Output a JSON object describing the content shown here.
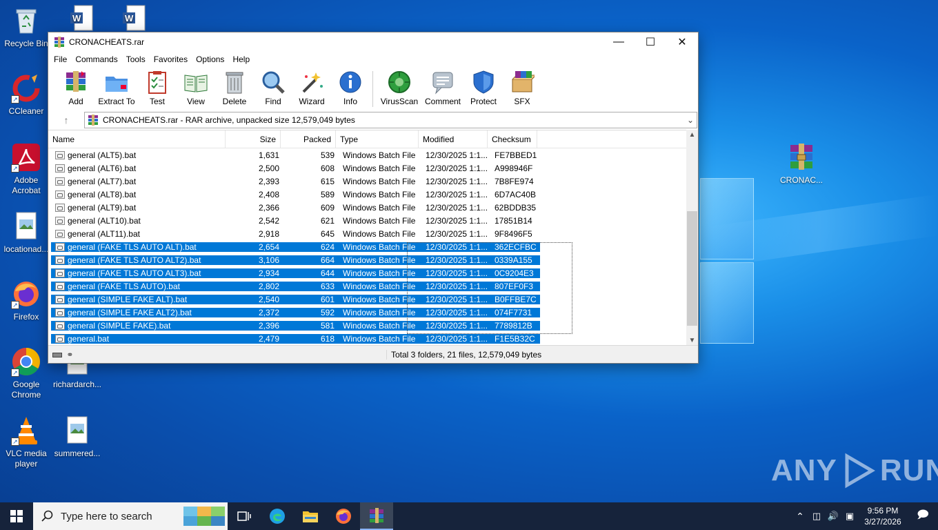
{
  "desktop": {
    "icons": [
      {
        "label": "Recycle Bin",
        "icon": "recycle-bin-icon"
      },
      {
        "label": "CCleaner",
        "icon": "ccleaner-icon"
      },
      {
        "label": "Adobe Acrobat",
        "icon": "acrobat-icon"
      },
      {
        "label": "locationad...",
        "icon": "image-file-icon"
      },
      {
        "label": "Firefox",
        "icon": "firefox-icon"
      },
      {
        "label": "Google Chrome",
        "icon": "chrome-icon"
      },
      {
        "label": "richardarch...",
        "icon": "image-file-icon"
      },
      {
        "label": "VLC media player",
        "icon": "vlc-icon"
      },
      {
        "label": "summered...",
        "icon": "image-file-icon"
      },
      {
        "label": "CRONAC...",
        "icon": "winrar-archive-icon"
      }
    ],
    "watermark": "ANY RUN"
  },
  "window": {
    "title": "CRONACHEATS.rar",
    "menu": [
      "File",
      "Commands",
      "Tools",
      "Favorites",
      "Options",
      "Help"
    ],
    "toolbar": [
      "Add",
      "Extract To",
      "Test",
      "View",
      "Delete",
      "Find",
      "Wizard",
      "Info",
      "VirusScan",
      "Comment",
      "Protect",
      "SFX"
    ],
    "address": "CRONACHEATS.rar - RAR archive, unpacked size 12,579,049 bytes",
    "columns": [
      "Name",
      "Size",
      "Packed",
      "Type",
      "Modified",
      "Checksum"
    ],
    "rows": [
      {
        "name": "general (ALT5).bat",
        "size": "1,631",
        "packed": "539",
        "type": "Windows Batch File",
        "modified": "12/30/2025 1:1...",
        "checksum": "FE7BBED1",
        "selected": false
      },
      {
        "name": "general (ALT6).bat",
        "size": "2,500",
        "packed": "608",
        "type": "Windows Batch File",
        "modified": "12/30/2025 1:1...",
        "checksum": "A998946F",
        "selected": false
      },
      {
        "name": "general (ALT7).bat",
        "size": "2,393",
        "packed": "615",
        "type": "Windows Batch File",
        "modified": "12/30/2025 1:1...",
        "checksum": "7B8FE974",
        "selected": false
      },
      {
        "name": "general (ALT8).bat",
        "size": "2,408",
        "packed": "589",
        "type": "Windows Batch File",
        "modified": "12/30/2025 1:1...",
        "checksum": "6D7AC40B",
        "selected": false
      },
      {
        "name": "general (ALT9).bat",
        "size": "2,366",
        "packed": "609",
        "type": "Windows Batch File",
        "modified": "12/30/2025 1:1...",
        "checksum": "62BDDB35",
        "selected": false
      },
      {
        "name": "general (ALT10).bat",
        "size": "2,542",
        "packed": "621",
        "type": "Windows Batch File",
        "modified": "12/30/2025 1:1...",
        "checksum": "17851B14",
        "selected": false
      },
      {
        "name": "general (ALT11).bat",
        "size": "2,918",
        "packed": "645",
        "type": "Windows Batch File",
        "modified": "12/30/2025 1:1...",
        "checksum": "9F8496F5",
        "selected": false
      },
      {
        "name": "general (FAKE TLS AUTO ALT).bat",
        "size": "2,654",
        "packed": "624",
        "type": "Windows Batch File",
        "modified": "12/30/2025 1:1...",
        "checksum": "362ECFBC",
        "selected": true
      },
      {
        "name": "general (FAKE TLS AUTO ALT2).bat",
        "size": "3,106",
        "packed": "664",
        "type": "Windows Batch File",
        "modified": "12/30/2025 1:1...",
        "checksum": "0339A155",
        "selected": true
      },
      {
        "name": "general (FAKE TLS AUTO ALT3).bat",
        "size": "2,934",
        "packed": "644",
        "type": "Windows Batch File",
        "modified": "12/30/2025 1:1...",
        "checksum": "0C9204E3",
        "selected": true
      },
      {
        "name": "general (FAKE TLS AUTO).bat",
        "size": "2,802",
        "packed": "633",
        "type": "Windows Batch File",
        "modified": "12/30/2025 1:1...",
        "checksum": "807EF0F3",
        "selected": true
      },
      {
        "name": "general (SIMPLE FAKE ALT).bat",
        "size": "2,540",
        "packed": "601",
        "type": "Windows Batch File",
        "modified": "12/30/2025 1:1...",
        "checksum": "B0FFBE7C",
        "selected": true
      },
      {
        "name": "general (SIMPLE FAKE ALT2).bat",
        "size": "2,372",
        "packed": "592",
        "type": "Windows Batch File",
        "modified": "12/30/2025 1:1...",
        "checksum": "074F7731",
        "selected": true
      },
      {
        "name": "general (SIMPLE FAKE).bat",
        "size": "2,396",
        "packed": "581",
        "type": "Windows Batch File",
        "modified": "12/30/2025 1:1...",
        "checksum": "7789812B",
        "selected": true
      },
      {
        "name": "general.bat",
        "size": "2,479",
        "packed": "618",
        "type": "Windows Batch File",
        "modified": "12/30/2025 1:1...",
        "checksum": "F1E5B32C",
        "selected": true
      }
    ],
    "status": "Total 3 folders, 21 files, 12,579,049 bytes"
  },
  "taskbar": {
    "search_placeholder": "Type here to search",
    "time": "9:56 PM",
    "date": "3/27/2026"
  }
}
